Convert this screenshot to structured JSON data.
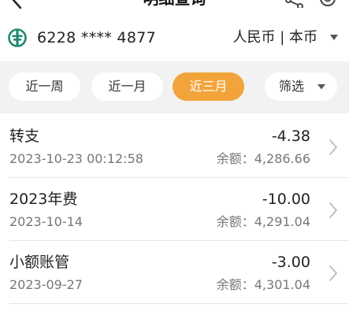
{
  "header": {
    "title": "明细查询",
    "back_icon": "chevron-left-icon",
    "action_icons": [
      "share-icon",
      "settings-icon"
    ]
  },
  "account": {
    "number": "6228 **** 4877",
    "currency_label": "人民币 | 本币",
    "logo_icon": "abc-bank-logo",
    "logo_color": "#1f8a70"
  },
  "filters": {
    "week": "近一周",
    "month": "近一月",
    "three_months": "近三月",
    "filter": "筛选",
    "active": "three_months",
    "active_color": "#f2a43b"
  },
  "transactions": [
    {
      "title": "转支",
      "datetime": "2023-10-23 00:12:58",
      "amount": "-4.38",
      "balance_label": "余额：",
      "balance": "4,286.66"
    },
    {
      "title": "2023年费",
      "datetime": "2023-10-14",
      "amount": "-10.00",
      "balance_label": "余额：",
      "balance": "4,291.04"
    },
    {
      "title": "小额账管",
      "datetime": "2023-09-27",
      "amount": "-3.00",
      "balance_label": "余额：",
      "balance": "4,301.04"
    }
  ]
}
